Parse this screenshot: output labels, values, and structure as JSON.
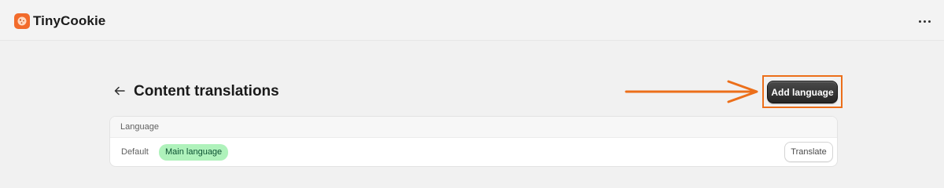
{
  "app": {
    "title": "TinyCookie",
    "logo_icon": "cookie-icon",
    "brand_color": "#f26b2b"
  },
  "header": {
    "more_icon": "more-horizontal-icon"
  },
  "page": {
    "back_icon": "arrow-left-icon",
    "title": "Content translations",
    "primary_action": "Add language"
  },
  "annotation": {
    "color": "#ec6f1a"
  },
  "table": {
    "column_header": "Language",
    "rows": [
      {
        "label": "Default",
        "badge": "Main language",
        "badge_color": "#aff2bb",
        "action": "Translate"
      }
    ]
  }
}
